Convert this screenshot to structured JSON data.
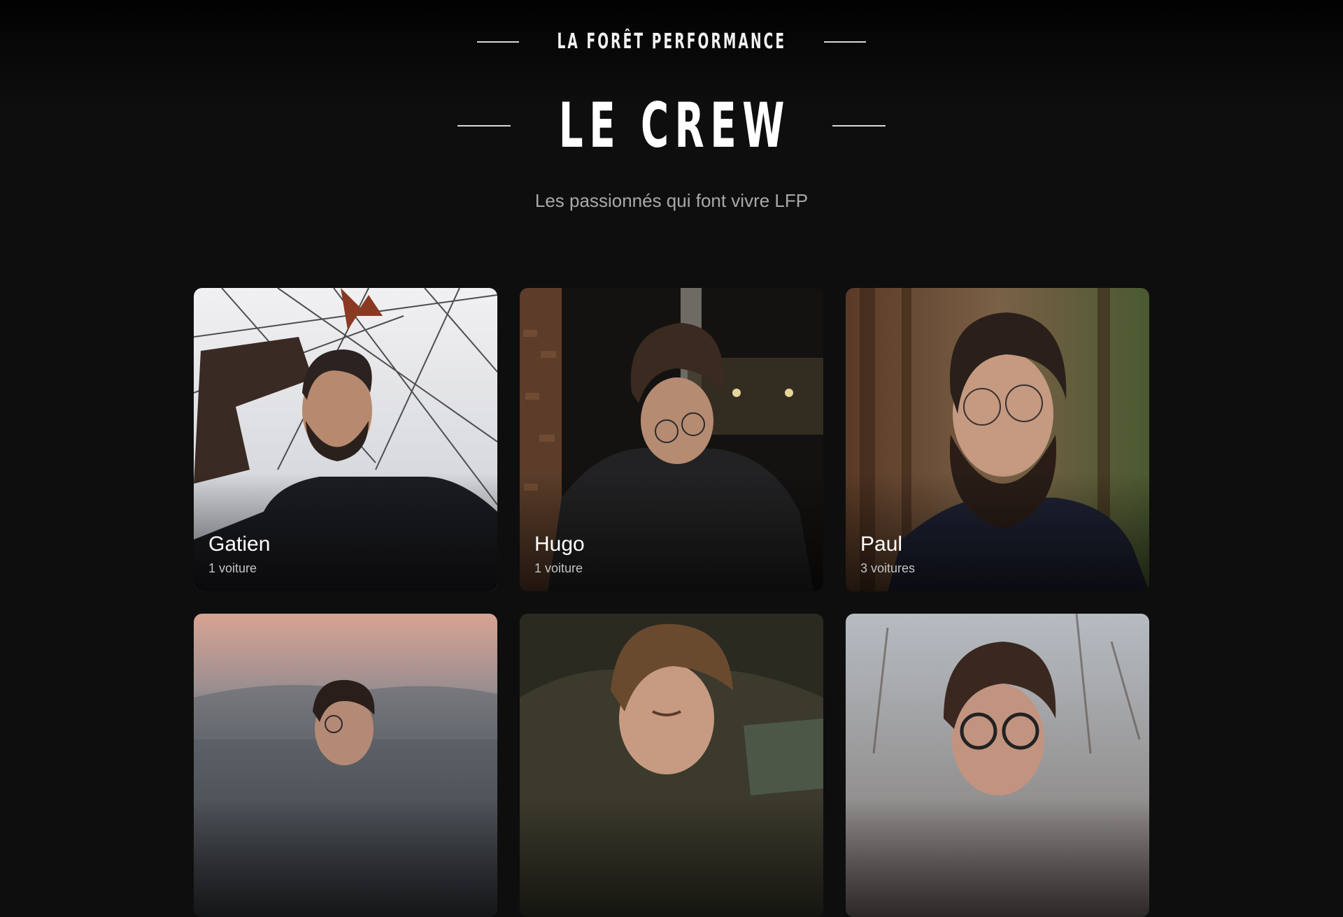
{
  "header": {
    "brand": "LA FORÊT PERFORMANCE",
    "title": "LE CREW",
    "subtitle": "Les passionnés qui font vivre LFP"
  },
  "crew": [
    {
      "name": "Gatien",
      "cars": "1 voiture"
    },
    {
      "name": "Hugo",
      "cars": "1 voiture"
    },
    {
      "name": "Paul",
      "cars": "3 voitures"
    },
    {
      "name": "",
      "cars": ""
    },
    {
      "name": "",
      "cars": ""
    },
    {
      "name": "",
      "cars": ""
    }
  ],
  "colors": {
    "background": "#0e0e0e",
    "subtitle": "#a9a9a9"
  }
}
